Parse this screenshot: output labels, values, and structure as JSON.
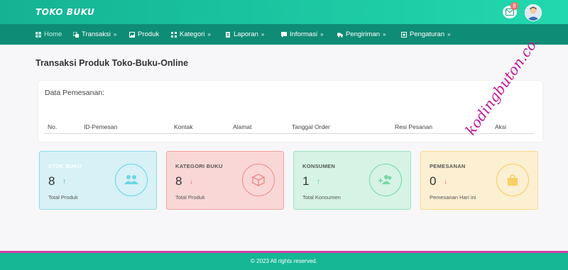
{
  "header": {
    "brand": "TOKO BUKU",
    "notification_count": "8"
  },
  "nav": [
    {
      "label": "Home",
      "icon": "dashboard-icon",
      "chevron": false
    },
    {
      "label": "Transaksi",
      "icon": "exchange-icon",
      "chevron": true
    },
    {
      "label": "Produk",
      "icon": "image-icon",
      "chevron": false
    },
    {
      "label": "Kategori",
      "icon": "grid-icon",
      "chevron": true
    },
    {
      "label": "Laporan",
      "icon": "report-icon",
      "chevron": true
    },
    {
      "label": "Informasi",
      "icon": "chat-icon",
      "chevron": true
    },
    {
      "label": "Pengiriman",
      "icon": "truck-icon",
      "chevron": true
    },
    {
      "label": "Pengaturan",
      "icon": "settings-icon",
      "chevron": true
    }
  ],
  "page": {
    "title": "Transaksi Produk Toko-Buku-Online"
  },
  "orders": {
    "label": "Data Pemesanan:",
    "columns": [
      "No.",
      "ID-Pemesan",
      "Kontak",
      "Alamat",
      "Tanggal Order",
      "Resi Pesanan",
      "Aksi"
    ]
  },
  "stats": [
    {
      "label": "STOK BUKU",
      "value": "8",
      "trend": "up",
      "sub": "Total Produk",
      "icon": "users-icon",
      "color": "#6ed5e6"
    },
    {
      "label": "KATEGORI BUKU",
      "value": "8",
      "trend": "down",
      "sub": "Total Produk",
      "icon": "box-icon",
      "color": "#f08b8b"
    },
    {
      "label": "KONSUMEN",
      "value": "1",
      "trend": "up",
      "sub": "Total Konsumen",
      "icon": "user-plus-icon",
      "color": "#78d9a8"
    },
    {
      "label": "PEMESANAN",
      "value": "0",
      "trend": "down",
      "sub": "Pemesanan Hari ini",
      "icon": "shopping-bag-icon",
      "color": "#f7cf62"
    }
  ],
  "footer": {
    "text": "© 2023 All rights reserved."
  },
  "watermark": {
    "text": "kodingbuton.com"
  },
  "colors": {
    "topbar": "#1cc9a2",
    "navbar": "#0f8c75",
    "footer_accent": "#d43fa4",
    "watermark": "#c2189a"
  }
}
